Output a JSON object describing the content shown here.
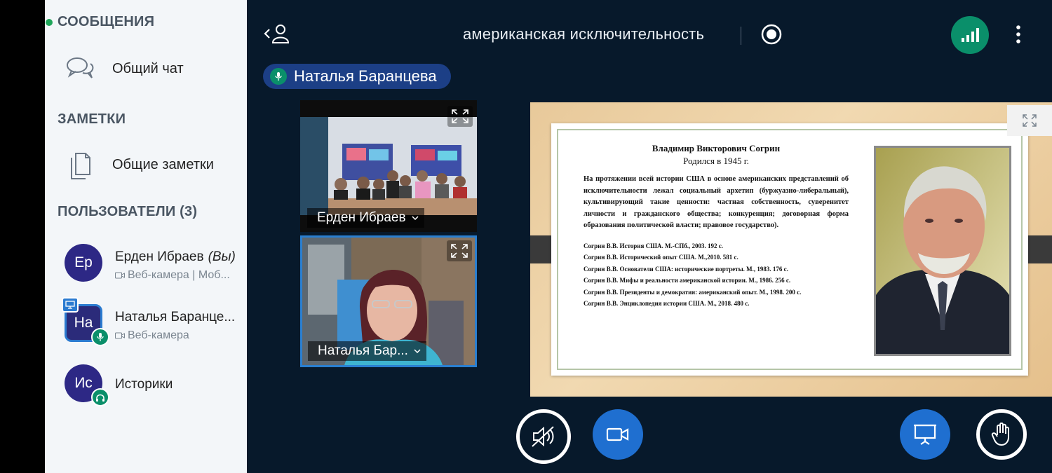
{
  "sidebar": {
    "messages_title": "СООБЩЕНИЯ",
    "public_chat": "Общий чат",
    "notes_title": "ЗАМЕТКИ",
    "shared_notes": "Общие заметки",
    "users_title": "ПОЛЬЗОВАТЕЛИ (3)",
    "users": [
      {
        "initials": "Ер",
        "name": "Ерден Ибраев",
        "you": "(Вы)",
        "sub": "Веб-камера | Моб..."
      },
      {
        "initials": "На",
        "name": "Наталья Баранце...",
        "sub": "Веб-камера"
      },
      {
        "initials": "Ис",
        "name": "Историки",
        "sub": ""
      }
    ]
  },
  "topbar": {
    "title": "американская исключительность"
  },
  "talking": {
    "name": "Наталья Баранцева"
  },
  "videos": [
    {
      "label": "Ерден Ибраев"
    },
    {
      "label": "Наталья Бар..."
    }
  ],
  "slide": {
    "heading": "Владимир Викторович Согрин",
    "born": "Родился в 1945 г.",
    "paragraph": "На протяжении всей истории США в основе американских представлений об исключительности лежал социальный архетип (буржуазно-либеральный), культивирующий такие ценности: частная собственность, суверенитет личности и гражданского общества; конкуренция; договорная форма образования политической власти; правовое государство).",
    "refs": [
      "Согрин В.В. История США. М.-СПб., 2003.  192 с.",
      "Согрин В.В. Исторический опыт США. М.,2010.  581 с.",
      "Согрин В.В. Основатели США: исторические портреты. М., 1983.  176 с.",
      "Согрин В.В. Мифы и реальности американской истории. М., 1986.  256 с.",
      "Согрин В.В. Президенты и демократия: американский опыт. М., 1998. 200 с.",
      "Согрин В.В. Энциклопедия истории США. М., 2018. 480 с."
    ]
  },
  "colors": {
    "main_bg": "#07192b",
    "sidebar_bg": "#f3f6f9",
    "accent_blue": "#1f6fd0",
    "accent_green": "#0a8f6a",
    "talking_bg": "#1c3f86"
  }
}
